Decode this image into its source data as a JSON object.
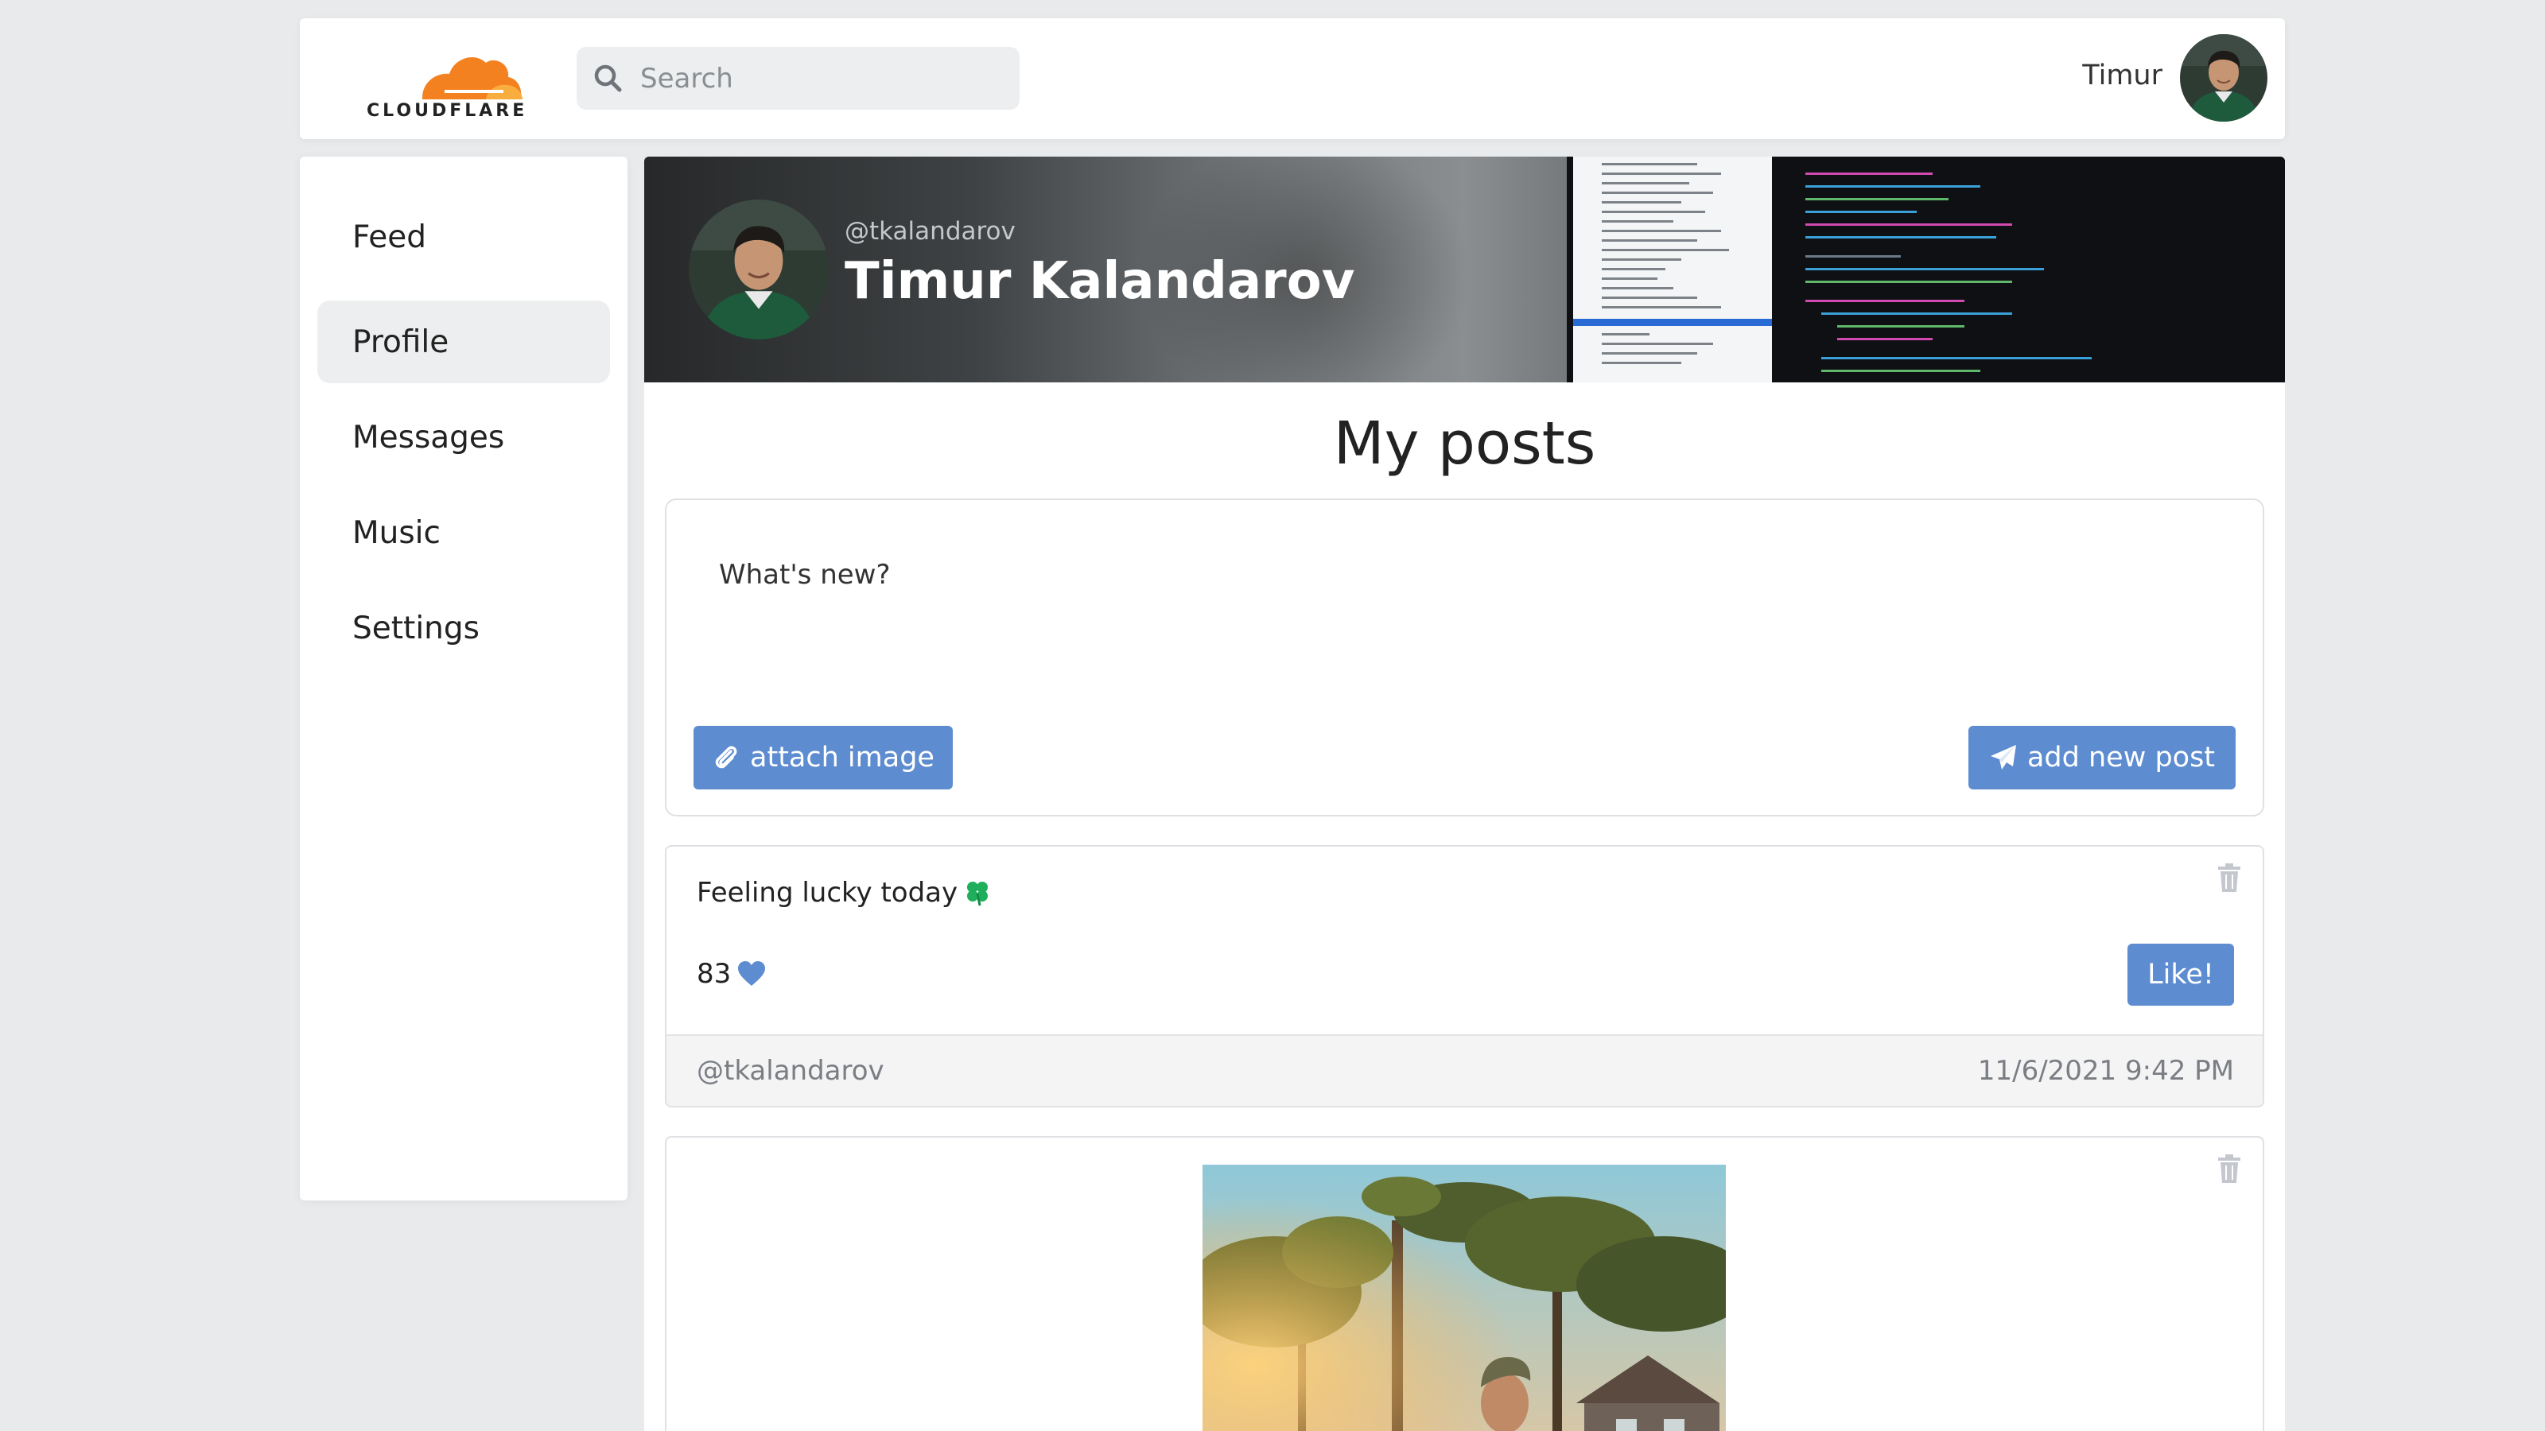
{
  "brand": {
    "logo_text": "CLOUDFLARE",
    "logo_colors": [
      "#f48120",
      "#faad3f"
    ]
  },
  "search": {
    "placeholder": "Search"
  },
  "user": {
    "name": "Timur"
  },
  "sidebar": {
    "items": [
      {
        "label": "Feed",
        "active": false
      },
      {
        "label": "Profile",
        "active": true
      },
      {
        "label": "Messages",
        "active": false
      },
      {
        "label": "Music",
        "active": false
      },
      {
        "label": "Settings",
        "active": false
      }
    ]
  },
  "profile": {
    "handle": "@tkalandarov",
    "full_name": "Timur Kalandarov"
  },
  "posts_section": {
    "title": "My posts"
  },
  "composer": {
    "placeholder": "What's new?",
    "attach_label": "attach image",
    "submit_label": "add new post"
  },
  "posts": [
    {
      "text": "Feeling lucky today",
      "emoji_icon": "four-leaf-clover-icon",
      "likes": "83",
      "like_label": "Like!",
      "author": "@tkalandarov",
      "timestamp": "11/6/2021 9:42 PM"
    },
    {
      "image": "photo of person outdoors with trees and house",
      "has_image": true
    }
  ],
  "colors": {
    "accent": "#5d8cd0",
    "page_background": "#e9eaec",
    "clover": "#1fae5b",
    "heart": "#5d8cd0"
  }
}
